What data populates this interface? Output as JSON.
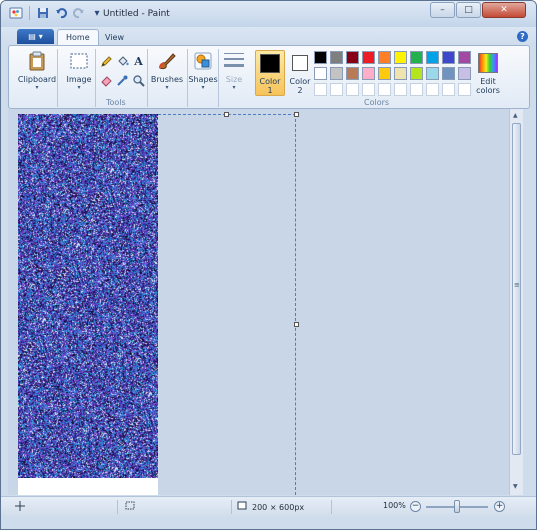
{
  "app": {
    "title": "Untitled - Paint"
  },
  "window_controls": {
    "minimize": "–",
    "maximize": "□",
    "close": "✕"
  },
  "tabs": [
    {
      "label": "Home",
      "active": true
    },
    {
      "label": "View",
      "active": false
    }
  ],
  "ribbon": {
    "clipboard": {
      "label": "Clipboard"
    },
    "image": {
      "label": "Image"
    },
    "tools": {
      "group_label": "Tools"
    },
    "brushes": {
      "label": "Brushes"
    },
    "shapes": {
      "label": "Shapes"
    },
    "size": {
      "label": "Size"
    },
    "color1": {
      "label_line1": "Color",
      "label_line2": "1",
      "value": "#000000"
    },
    "color2": {
      "label_line1": "Color",
      "label_line2": "2",
      "value": "#ffffff"
    },
    "colors_group_label": "Colors",
    "edit_colors": {
      "label_line1": "Edit",
      "label_line2": "colors"
    },
    "palette": [
      "#000000",
      "#7f7f7f",
      "#880015",
      "#ed1c24",
      "#ff7f27",
      "#fff200",
      "#22b14c",
      "#00a2e8",
      "#3f48cc",
      "#a349a4",
      "#ffffff",
      "#c3c3c3",
      "#b97a57",
      "#ffaec9",
      "#ffc90e",
      "#efe4b0",
      "#b5e61d",
      "#99d9ea",
      "#7092be",
      "#c8bfe7",
      "#ffffff",
      "#ffffff",
      "#ffffff",
      "#ffffff",
      "#ffffff",
      "#ffffff",
      "#ffffff",
      "#ffffff",
      "#ffffff",
      "#ffffff"
    ]
  },
  "status": {
    "dimensions": "200 × 600px",
    "zoom": "100%",
    "zoom_level": 0.5
  }
}
